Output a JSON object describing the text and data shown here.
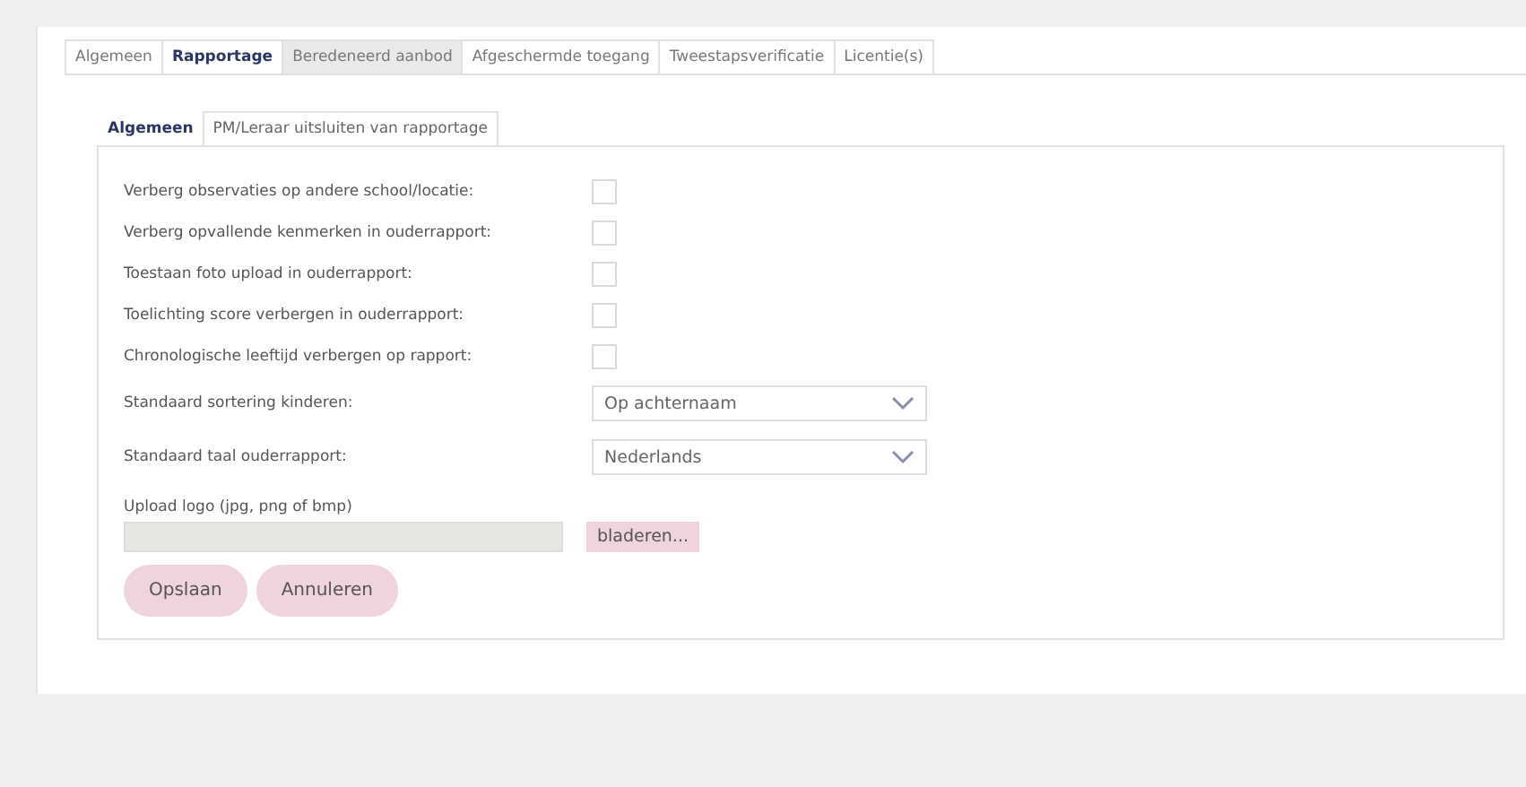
{
  "tabs": [
    {
      "label": "Algemeen",
      "selected": false,
      "hovered": false
    },
    {
      "label": "Rapportage",
      "selected": true,
      "hovered": false
    },
    {
      "label": "Beredeneerd aanbod",
      "selected": false,
      "hovered": true
    },
    {
      "label": "Afgeschermde toegang",
      "selected": false,
      "hovered": false
    },
    {
      "label": "Tweestapsverificatie",
      "selected": false,
      "hovered": false
    },
    {
      "label": "Licentie(s)",
      "selected": false,
      "hovered": false
    }
  ],
  "subtabs": [
    {
      "label": "Algemeen",
      "selected": true
    },
    {
      "label": "PM/Leraar uitsluiten van rapportage",
      "selected": false
    }
  ],
  "settings": [
    {
      "kind": "checkbox",
      "label": "Verberg observaties op andere school/locatie:",
      "checked": false
    },
    {
      "kind": "checkbox",
      "label": "Verberg opvallende kenmerken in ouderrapport:",
      "checked": false
    },
    {
      "kind": "checkbox",
      "label": "Toestaan foto upload in ouderrapport:",
      "checked": false
    },
    {
      "kind": "checkbox",
      "label": "Toelichting score verbergen in ouderrapport:",
      "checked": false
    },
    {
      "kind": "checkbox",
      "label": "Chronologische leeftijd verbergen op rapport:",
      "checked": false
    },
    {
      "kind": "select",
      "label": "Standaard sortering kinderen:",
      "value": "Op achternaam"
    },
    {
      "kind": "select",
      "label": "Standaard taal ouderrapport:",
      "value": "Nederlands"
    }
  ],
  "upload": {
    "label": "Upload logo (jpg, png of bmp)",
    "browse": "bladeren..."
  },
  "buttons": [
    "Opslaan",
    "Annuleren"
  ]
}
